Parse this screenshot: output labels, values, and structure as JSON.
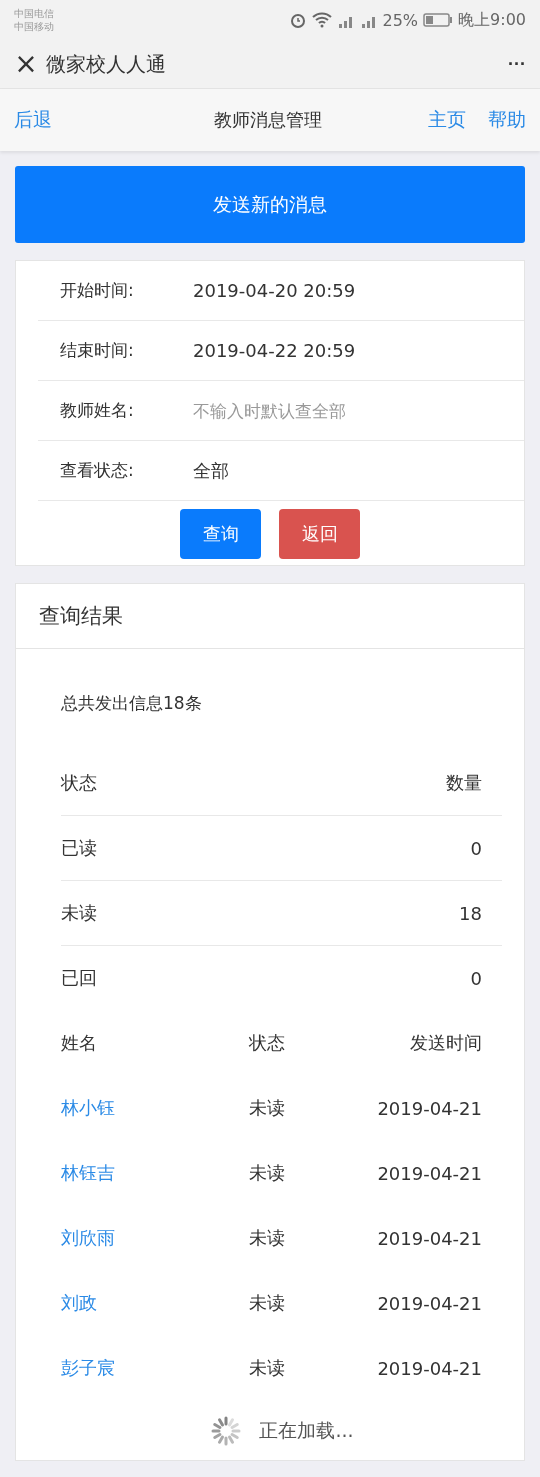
{
  "status_bar": {
    "carriers": [
      "中国电信",
      "中国移动"
    ],
    "battery": "25%",
    "time": "晚上9:00"
  },
  "title_bar": {
    "close": "×",
    "title": "微家校人人通",
    "more": "···"
  },
  "nav": {
    "back": "后退",
    "title": "教师消息管理",
    "links": [
      "主页",
      "帮助"
    ]
  },
  "send_button": "发送新的消息",
  "form": {
    "fields": [
      {
        "kind": "value",
        "label": "开始时间:",
        "value": "2019-04-20 20:59"
      },
      {
        "kind": "value",
        "label": "结束时间:",
        "value": "2019-04-22 20:59"
      },
      {
        "kind": "input",
        "label": "教师姓名:",
        "placeholder": "不输入时默认查全部"
      },
      {
        "kind": "value",
        "label": "查看状态:",
        "value": "全部"
      }
    ],
    "buttons": [
      {
        "kind": "primary",
        "label": "查询"
      },
      {
        "kind": "danger",
        "label": "返回"
      }
    ]
  },
  "results": {
    "title": "查询结果",
    "summary": "总共发出信息18条",
    "stats": {
      "columns": [
        "状态",
        "数量"
      ],
      "rows": [
        [
          "已读",
          "0"
        ],
        [
          "未读",
          "18"
        ],
        [
          "已回",
          "0"
        ]
      ]
    },
    "messages": {
      "columns": [
        "姓名",
        "状态",
        "发送时间"
      ],
      "rows": [
        {
          "name": "林小钰",
          "status": "未读",
          "time": "2019-04-21"
        },
        {
          "name": "林钰吉",
          "status": "未读",
          "time": "2019-04-21"
        },
        {
          "name": "刘欣雨",
          "status": "未读",
          "time": "2019-04-21"
        },
        {
          "name": "刘政",
          "status": "未读",
          "time": "2019-04-21"
        },
        {
          "name": "彭子宸",
          "status": "未读",
          "time": "2019-04-21"
        }
      ]
    },
    "loading": "正在加载..."
  }
}
